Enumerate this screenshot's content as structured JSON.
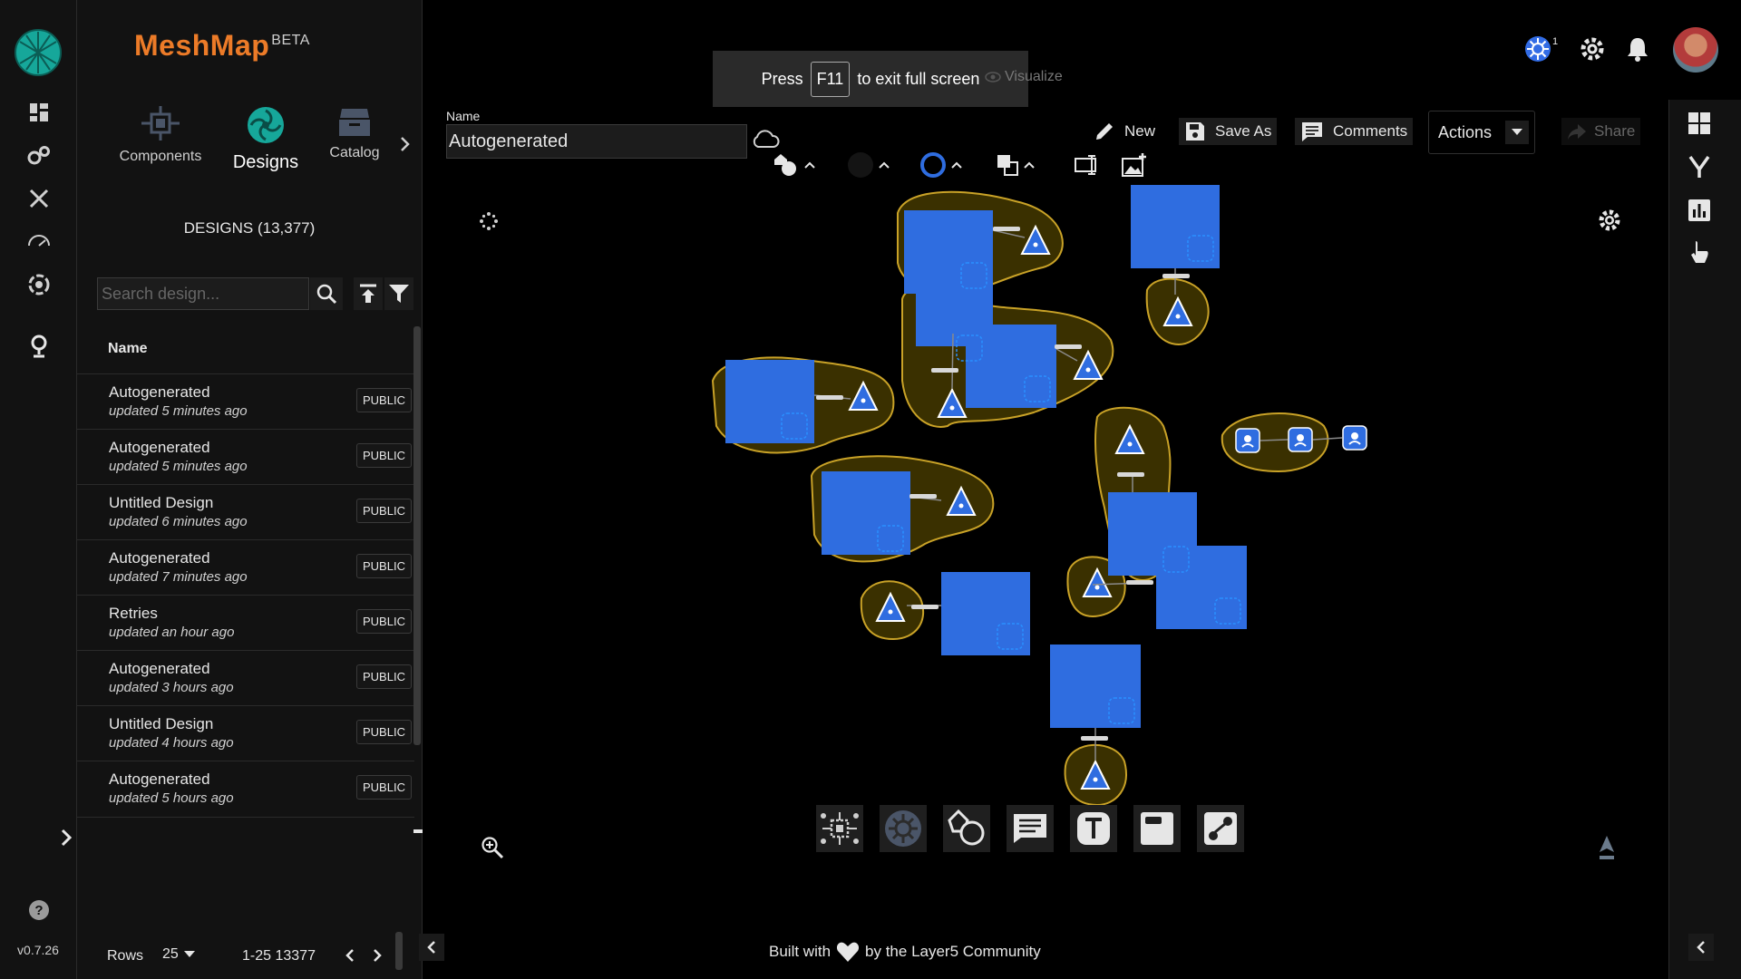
{
  "app": {
    "brand": "MeshMap",
    "beta": "BETA",
    "version": "v0.7.26"
  },
  "sidebar": {
    "tabs": [
      {
        "label": "Components",
        "icon": "components-icon"
      },
      {
        "label": "Designs",
        "icon": "designs-icon",
        "active": true
      },
      {
        "label": "Catalog",
        "icon": "catalog-icon"
      }
    ],
    "count_label": "DESIGNS (13,377)",
    "search_placeholder": "Search design...",
    "column_header": "Name",
    "designs": [
      {
        "name": "Autogenerated",
        "updated": "updated 5 minutes ago",
        "visibility": "PUBLIC"
      },
      {
        "name": "Autogenerated",
        "updated": "updated 5 minutes ago",
        "visibility": "PUBLIC"
      },
      {
        "name": "Untitled Design",
        "updated": "updated 6 minutes ago",
        "visibility": "PUBLIC"
      },
      {
        "name": "Autogenerated",
        "updated": "updated 7 minutes ago",
        "visibility": "PUBLIC"
      },
      {
        "name": "Retries",
        "updated": "updated an hour ago",
        "visibility": "PUBLIC"
      },
      {
        "name": "Autogenerated",
        "updated": "updated 3 hours ago",
        "visibility": "PUBLIC"
      },
      {
        "name": "Untitled Design",
        "updated": "updated 4 hours ago",
        "visibility": "PUBLIC"
      },
      {
        "name": "Autogenerated",
        "updated": "updated 5 hours ago",
        "visibility": "PUBLIC"
      }
    ],
    "pager": {
      "rows_label": "Rows",
      "rows_value": "25",
      "range": "1-25 13377"
    }
  },
  "toolbar": {
    "name_label": "Name",
    "name_value": "Autogenerated",
    "new_label": "New",
    "save_as_label": "Save As",
    "comments_label": "Comments",
    "actions_label": "Actions",
    "share_label": "Share",
    "visualize_label": "Visualize"
  },
  "fullscreen_toast": {
    "press": "Press",
    "key": "F11",
    "rest": "to exit full screen"
  },
  "header": {
    "k8s_badge": "1"
  },
  "footer": {
    "built_with": "Built with",
    "by": "by the Layer5 Community"
  },
  "colors": {
    "brand": "#ec7b28",
    "node_blue": "#2f6de0",
    "group_fill": "#3a3000",
    "group_stroke": "#c9a227"
  }
}
